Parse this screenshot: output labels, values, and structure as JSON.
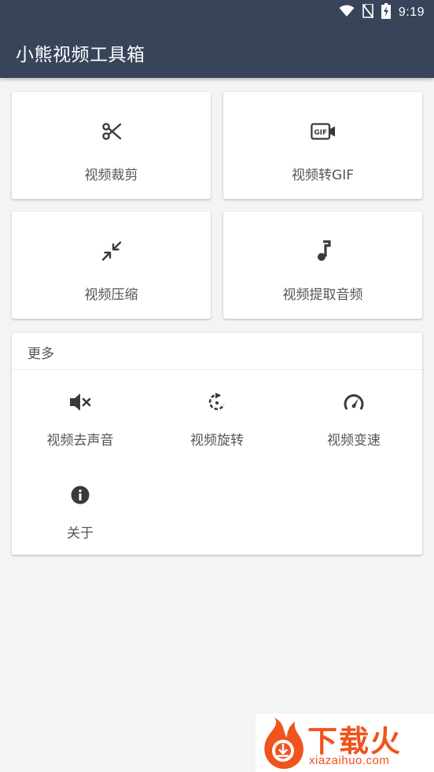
{
  "status_bar": {
    "time": "9:19",
    "icons": [
      "wifi-icon",
      "no-sim-icon",
      "battery-charging-icon"
    ]
  },
  "app_bar": {
    "title": "小熊视频工具箱"
  },
  "tools": [
    {
      "label": "视频裁剪",
      "icon": "scissors-icon"
    },
    {
      "label": "视频转GIF",
      "icon": "gif-icon"
    },
    {
      "label": "视频压缩",
      "icon": "compress-icon"
    },
    {
      "label": "视频提取音频",
      "icon": "music-note-icon"
    }
  ],
  "more": {
    "title": "更多",
    "items": [
      {
        "label": "视频去声音",
        "icon": "volume-mute-icon"
      },
      {
        "label": "视频旋转",
        "icon": "rotate-icon"
      },
      {
        "label": "视频变速",
        "icon": "speedometer-icon"
      },
      {
        "label": "关于",
        "icon": "info-icon"
      }
    ]
  },
  "watermark": {
    "brand": "下载火",
    "domain": "xiazaihuo.com"
  },
  "colors": {
    "app_bar": "#37445a",
    "background": "#f4f4f4",
    "icon": "#3a3a3a",
    "label": "#555555",
    "watermark": "#f0531c"
  }
}
